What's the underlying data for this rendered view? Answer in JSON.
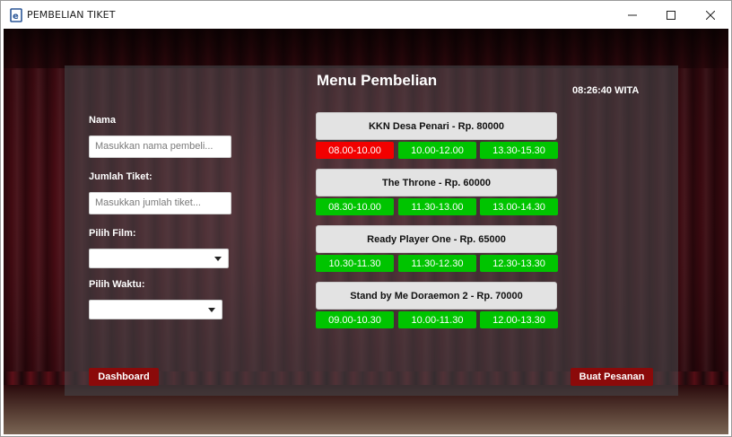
{
  "window": {
    "title": "PEMBELIAN TIKET",
    "icon": "app-e-icon",
    "controls": [
      "minimize-icon",
      "maximize-icon",
      "close-icon"
    ]
  },
  "panel": {
    "title": "Menu Pembelian",
    "clock": "08:26:40 WITA"
  },
  "form": {
    "name_label": "Nama",
    "name_placeholder": "Masukkan nama pembeli...",
    "qty_label": "Jumlah Tiket:",
    "qty_placeholder": "Masukkan jumlah tiket...",
    "film_label": "Pilih Film:",
    "film_value": "",
    "time_label": "Pilih Waktu:",
    "time_value": ""
  },
  "films": [
    {
      "label": "KKN Desa Penari - Rp. 80000",
      "times": [
        "08.00-10.00",
        "10.00-12.00",
        "13.30-15.30"
      ],
      "time_colors": [
        "#f20000",
        "#00c400",
        "#00c400"
      ]
    },
    {
      "label": "The Throne - Rp. 60000",
      "times": [
        "08.30-10.00",
        "11.30-13.00",
        "13.00-14.30"
      ],
      "time_colors": [
        "#00c400",
        "#00c400",
        "#00c400"
      ]
    },
    {
      "label": "Ready Player One - Rp. 65000",
      "times": [
        "10.30-11.30",
        "11.30-12.30",
        "12.30-13.30"
      ],
      "time_colors": [
        "#00c400",
        "#00c400",
        "#00c400"
      ]
    },
    {
      "label": "Stand by Me Doraemon 2 - Rp. 70000",
      "times": [
        "09.00-10.30",
        "10.00-11.30",
        "12.00-13.30"
      ],
      "time_colors": [
        "#00c400",
        "#00c400",
        "#00c400"
      ]
    }
  ],
  "actions": {
    "dashboard_label": "Dashboard",
    "order_label": "Buat Pesanan"
  },
  "colors": {
    "accent_red": "#8b0a0a",
    "available_green": "#00c400",
    "unavailable_red": "#f20000"
  }
}
